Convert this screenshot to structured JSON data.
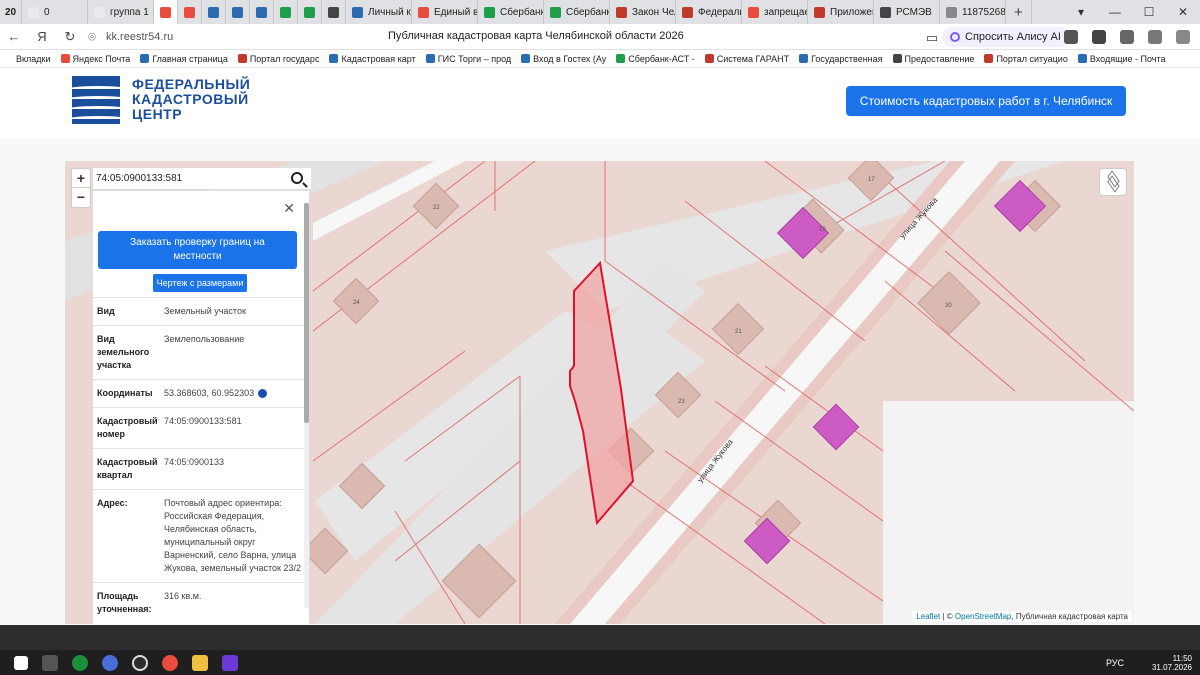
{
  "browser": {
    "tabs": [
      {
        "label": "20",
        "color": "#fff"
      },
      {
        "label": "0",
        "color": "#e8eaed"
      },
      {
        "label": "группа 1",
        "color": "#e8eaed"
      },
      {
        "label": "",
        "color": "#e94c3d"
      },
      {
        "label": "",
        "color": "#e94c3d"
      },
      {
        "label": "",
        "color": "#2b6cb0"
      },
      {
        "label": "",
        "color": "#2b6cb0"
      },
      {
        "label": "",
        "color": "#2b6cb0"
      },
      {
        "label": "",
        "color": "#1e9e4a"
      },
      {
        "label": "",
        "color": "#1e9e4a"
      },
      {
        "label": "",
        "color": "#444"
      },
      {
        "label": "Личный ка",
        "color": "#2b6cb0"
      },
      {
        "label": "Единый вх",
        "color": "#e94c3d"
      },
      {
        "label": "Сбербанк",
        "color": "#1e9e4a"
      },
      {
        "label": "Сбербанк",
        "color": "#1e9e4a"
      },
      {
        "label": "Закон Чел",
        "color": "#c0392b"
      },
      {
        "label": "Федераль",
        "color": "#c0392b"
      },
      {
        "label": "запрещае",
        "color": "#e94c3d"
      },
      {
        "label": "Приложен",
        "color": "#c0392b"
      },
      {
        "label": "РСМЭВ",
        "color": "#444"
      },
      {
        "label": "11875268",
        "color": "#888"
      }
    ],
    "url": "kk.reestr54.ru",
    "page_title": "Публичная кадастровая карта Челябинской области 2026",
    "alisa_label": "Спросить Алису AI",
    "bookmarks": [
      {
        "label": "Вкладки",
        "color": "#ffffff"
      },
      {
        "label": "Яндекс Почта",
        "color": "#e94c3d"
      },
      {
        "label": "Главная страница",
        "color": "#2b6cb0"
      },
      {
        "label": "Портал государс",
        "color": "#c0392b"
      },
      {
        "label": "Кадастровая карт",
        "color": "#2b6cb0"
      },
      {
        "label": "ГИС Торги – прод",
        "color": "#2b6cb0"
      },
      {
        "label": "Вход в Гостех (Ау",
        "color": "#2b6cb0"
      },
      {
        "label": "Сбербанк-АСТ -",
        "color": "#1e9e4a"
      },
      {
        "label": "Система ГАРАНТ",
        "color": "#c0392b"
      },
      {
        "label": "Государственная",
        "color": "#2b6cb0"
      },
      {
        "label": "Предоставление",
        "color": "#444"
      },
      {
        "label": "Портал ситуацио",
        "color": "#c0392b"
      },
      {
        "label": "Входящие - Почта",
        "color": "#2b6cb0"
      }
    ]
  },
  "site": {
    "logo_lines": [
      "ФЕДЕРАЛЬНЫЙ",
      "КАДАСТРОВЫЙ",
      "ЦЕНТР"
    ],
    "cta": "Стоимость кадастровых работ в г. Челябинск",
    "brand_color": "#1b4f9b",
    "accent_color": "#1a73e8"
  },
  "map": {
    "search_value": "74:05:0900133:581",
    "street_label_1": "улица Жукова",
    "street_label_2": "улица Жукова",
    "house_numbers": [
      "22",
      "24",
      "17",
      "19",
      "21",
      "23",
      "30"
    ],
    "attribution": {
      "leaflet": "Leaflet",
      "osm": "OpenStreetMap",
      "tail": ", Публичная кадастровая карта"
    },
    "zoom_in": "+",
    "zoom_out": "−"
  },
  "panel": {
    "order_button": "Заказать проверку границ на местности",
    "drawing_button": "Чертеж с размерами",
    "rows": [
      {
        "key": "Вид",
        "value": "Земельный участок"
      },
      {
        "key": "Вид земельного участка",
        "value": "Землепользование"
      },
      {
        "key": "Координаты",
        "value": "53.368603, 60.952303"
      },
      {
        "key": "Кадастровый номер",
        "value": "74:05:0900133:581"
      },
      {
        "key": "Кадастровый квартал",
        "value": "74:05:0900133"
      },
      {
        "key": "Адрес:",
        "value": "Почтовый адрес ориентира: Российская Федерация, Челябинская область, муниципальный округ Варненский, село Варна, улица Жукова, земельный участок 23/2"
      },
      {
        "key": "Площадь уточненная:",
        "value": "316 кв.м."
      }
    ]
  },
  "taskbar": {
    "language": "РУС",
    "time": "11:50",
    "date": "31.07.2026"
  }
}
